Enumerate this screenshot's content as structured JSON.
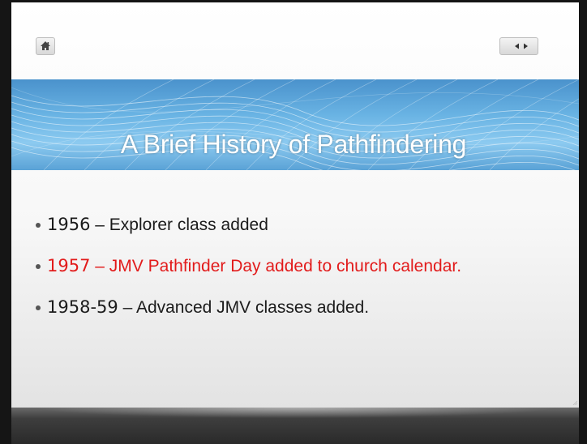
{
  "slide": {
    "title": "A Brief History of Pathfindering",
    "bullets": [
      {
        "year": "1956",
        "text": " – Explorer class added",
        "highlight": false
      },
      {
        "year": "1957",
        "text": " – JMV Pathfinder Day added to church calendar.",
        "highlight": true
      },
      {
        "year": "1958-59",
        "text": " – Advanced JMV classes added.",
        "highlight": false
      }
    ]
  },
  "nav": {
    "home_icon": "home-icon",
    "prev_icon": "prev-arrow-icon",
    "next_icon": "next-arrow-icon"
  },
  "colors": {
    "highlight": "#e21b1b",
    "banner": "#6ab4e4",
    "text": "#1b1b1b"
  }
}
